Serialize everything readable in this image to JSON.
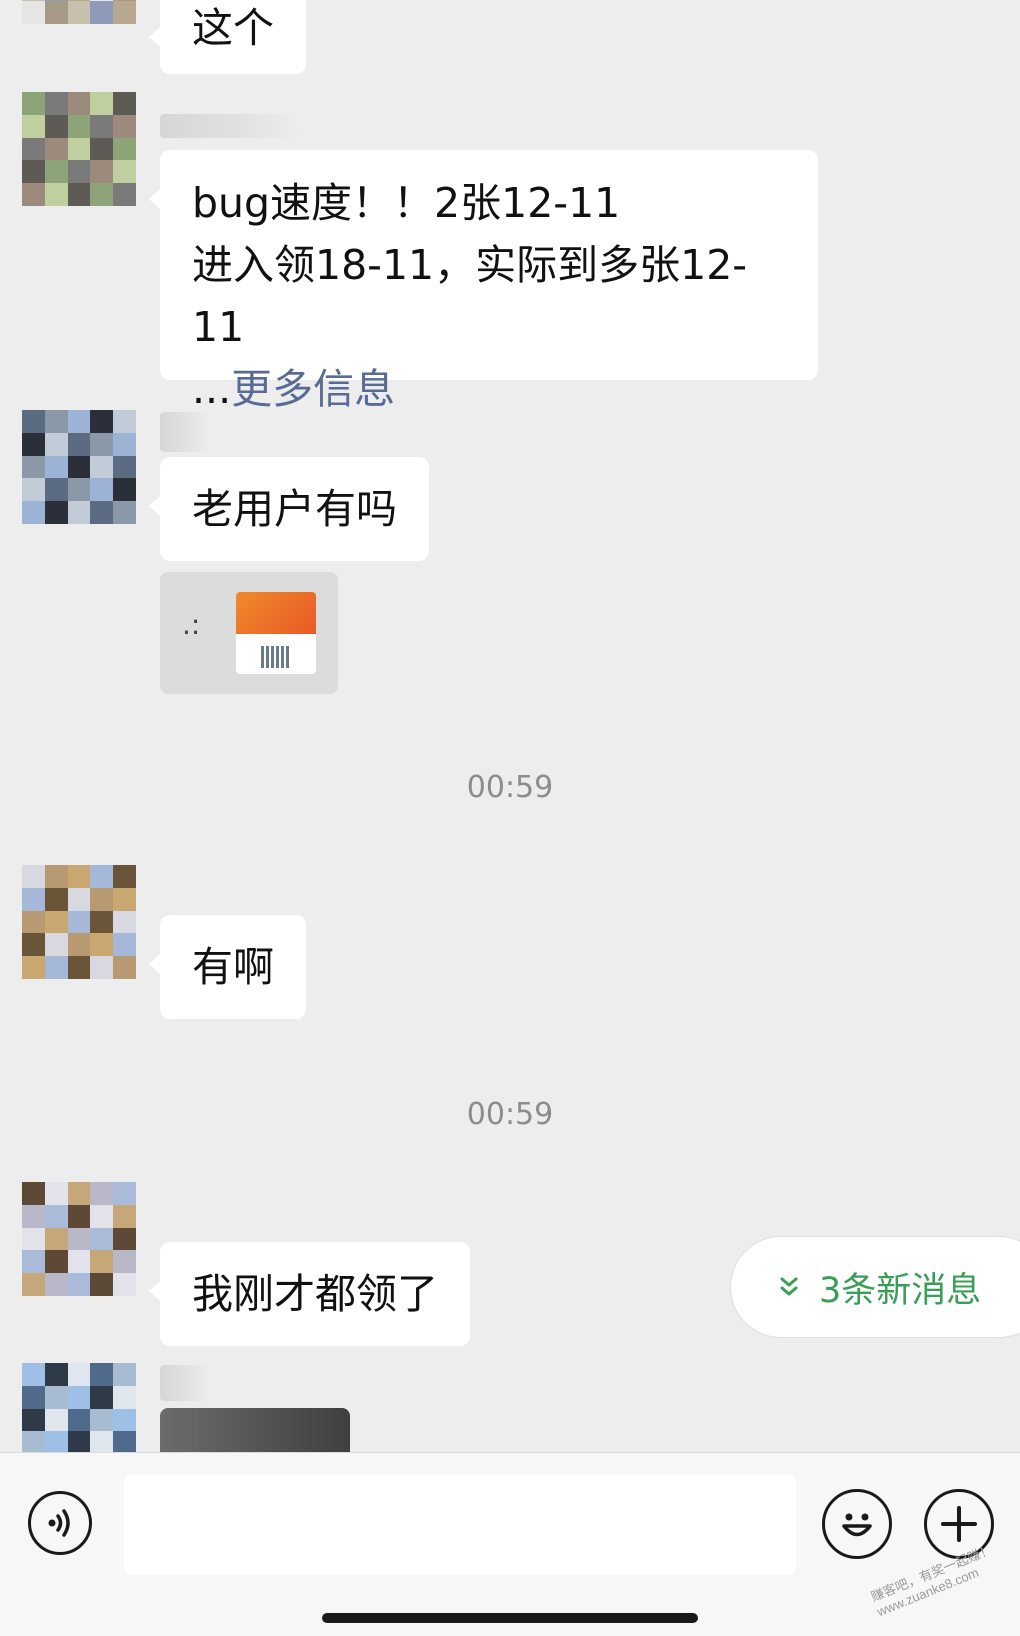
{
  "messages": [
    {
      "text": "这个"
    },
    {
      "lines": [
        "bug速度！！2张12-11",
        "进入领18-11，实际到多张12-11"
      ],
      "ellipsis": "...",
      "more_link": "更多信息"
    },
    {
      "text": "老用户有吗"
    },
    {
      "card_prefix": ".:"
    },
    {
      "timestamp": "00:59"
    },
    {
      "text": "有啊"
    },
    {
      "timestamp": "00:59"
    },
    {
      "text": "我刚才都领了"
    }
  ],
  "new_messages": {
    "label": "3条新消息",
    "color": "#3a9e56"
  },
  "input_bar": {
    "text_value": "",
    "voice_icon": "voice-icon",
    "emoji_icon": "emoji-icon",
    "plus_icon": "plus-icon"
  },
  "watermark": {
    "line1": "赚客吧，有奖一起赚！",
    "line2": "www.zuanke8.com"
  },
  "colors": {
    "background": "#ededed",
    "bubble": "#ffffff",
    "link": "#576b95",
    "accent_green": "#3a9e56"
  }
}
